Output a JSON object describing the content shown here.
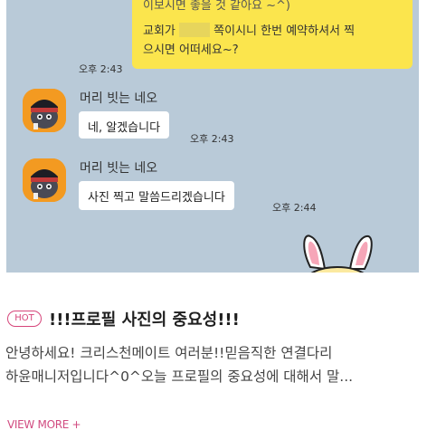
{
  "chat": {
    "top_bubble_cut_text": "이보시면 좋을 것 같아요 ~^)",
    "top_bubble_line1_a": "교회가",
    "top_bubble_line1_b": "쪽이시니 한번 예약하셔서 찍",
    "top_bubble_line2": "으시면 어떠세요~?",
    "time_1": "오후 2:43",
    "sender_name": "머리 빗는 네오",
    "message_1": "네, 알겠습니다",
    "time_2": "오후 2:43",
    "message_2": "사진 찍고 말씀드리겠습니다",
    "time_3": "오후 2:44"
  },
  "post": {
    "badge": "HOT",
    "title": "!!!프로필 사진의 중요성!!!",
    "excerpt_line1": "안녕하세요! 크리스천메이트 여러분!!믿음직한 연결다리",
    "excerpt_line2": "하윤매니저입니다^0^오늘 프로필의 중요성에 대해서 말...",
    "view_more": "VIEW MORE +"
  },
  "colors": {
    "chat_bg": "#b9cad8",
    "my_bubble": "#fbe54d",
    "accent": "#d6457a",
    "avatar_bg": "#f39a21"
  }
}
